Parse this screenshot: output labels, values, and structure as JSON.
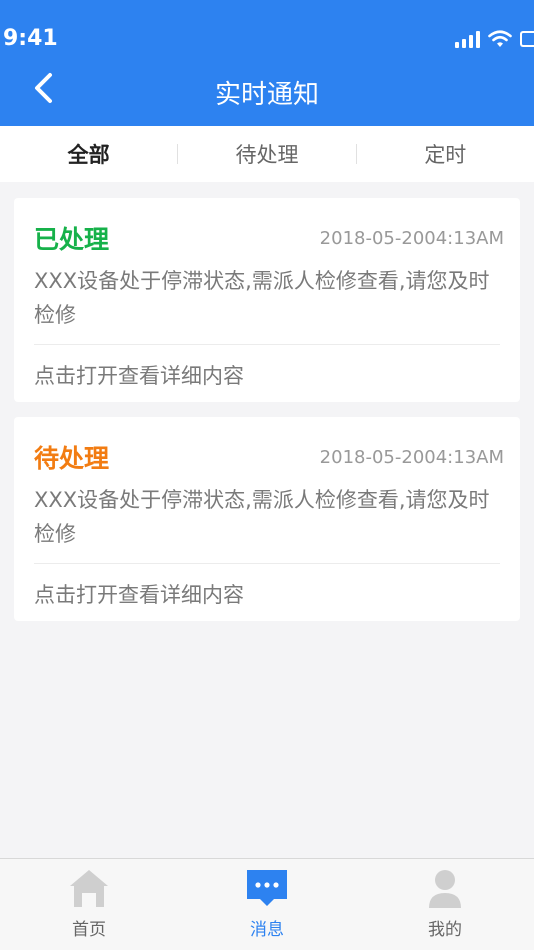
{
  "status_bar": {
    "time": "9:41"
  },
  "header": {
    "title": "实时通知"
  },
  "tabs": [
    {
      "label": "全部",
      "active": true
    },
    {
      "label": "待处理",
      "active": false
    },
    {
      "label": "定时",
      "active": false
    }
  ],
  "notifications": [
    {
      "status": "已处理",
      "status_color": "#16b14a",
      "time": "2018-05-2004:13AM",
      "message": "XXX设备处于停滞状态,需派人检修查看,请您及时检修",
      "link": "点击打开查看详细内容"
    },
    {
      "status": "待处理",
      "status_color": "#f27c12",
      "time": "2018-05-2004:13AM",
      "message": "XXX设备处于停滞状态,需派人检修查看,请您及时检修",
      "link": "点击打开查看详细内容"
    }
  ],
  "bottom_nav": [
    {
      "label": "首页",
      "icon": "home-icon",
      "active": false
    },
    {
      "label": "消息",
      "icon": "message-icon",
      "active": true
    },
    {
      "label": "我的",
      "icon": "user-icon",
      "active": false
    }
  ],
  "colors": {
    "primary": "#2d82f0",
    "inactive_icon": "#cfcfcf"
  }
}
